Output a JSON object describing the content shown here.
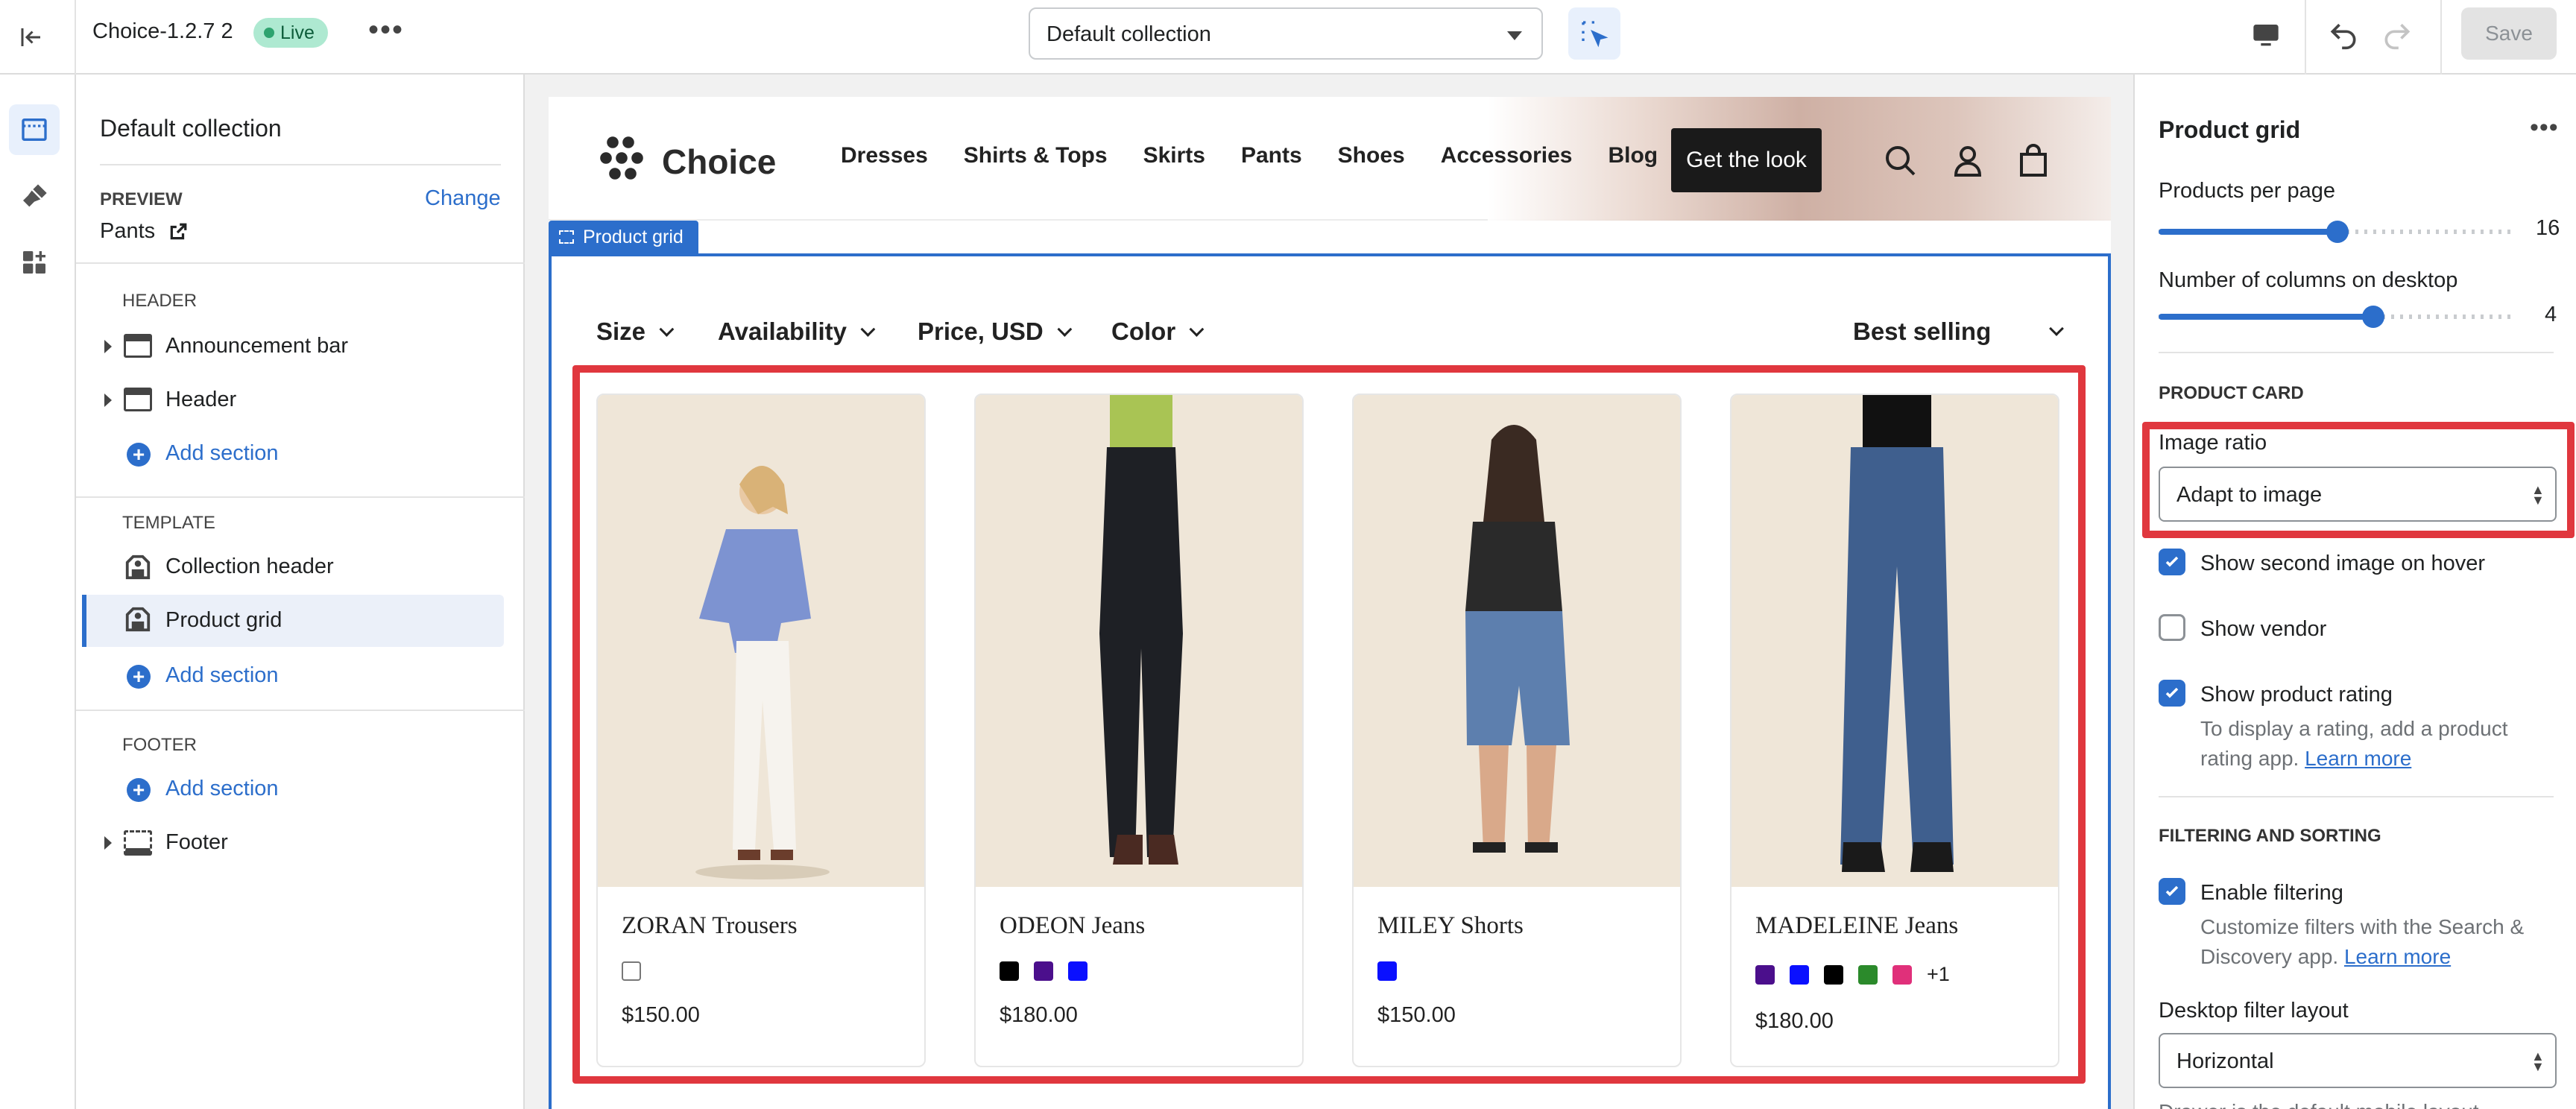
{
  "topbar": {
    "theme_name": "Choice-1.2.7 2",
    "live_badge": "Live",
    "template_select": "Default collection",
    "save_label": "Save"
  },
  "sidebar": {
    "title": "Default collection",
    "preview_label": "PREVIEW",
    "change_label": "Change",
    "preview_value": "Pants",
    "header_group": "HEADER",
    "announcement_bar": "Announcement bar",
    "header_item": "Header",
    "add_section": "Add section",
    "template_group": "TEMPLATE",
    "collection_header": "Collection header",
    "product_grid": "Product grid",
    "footer_group": "FOOTER",
    "footer_item": "Footer"
  },
  "store": {
    "logo_text": "Choice",
    "nav": [
      "Dresses",
      "Shirts & Tops",
      "Skirts",
      "Pants",
      "Shoes",
      "Accessories",
      "Blog"
    ],
    "cta": "Get the look",
    "section_tag": "Product grid",
    "filters": [
      "Size",
      "Availability",
      "Price, USD",
      "Color"
    ],
    "sort": "Best selling",
    "products": [
      {
        "name": "ZORAN Trousers",
        "price": "$150.00",
        "swatches": [
          "#ffffff"
        ],
        "more": ""
      },
      {
        "name": "ODEON Jeans",
        "price": "$180.00",
        "swatches": [
          "#000000",
          "#4b0f8c",
          "#0a10ff"
        ],
        "more": ""
      },
      {
        "name": "MILEY Shorts",
        "price": "$150.00",
        "swatches": [
          "#0a10ff"
        ],
        "more": ""
      },
      {
        "name": "MADELEINE Jeans",
        "price": "$180.00",
        "swatches": [
          "#4b0f8c",
          "#0a10ff",
          "#000000",
          "#2b8a2b",
          "#e0307a"
        ],
        "more": "+1"
      }
    ]
  },
  "settings": {
    "title": "Product grid",
    "products_per_page_label": "Products per page",
    "products_per_page_value": "16",
    "products_per_page_fraction": 0.5,
    "columns_label": "Number of columns on desktop",
    "columns_value": "4",
    "columns_fraction": 0.6,
    "product_card_heading": "PRODUCT CARD",
    "image_ratio_label": "Image ratio",
    "image_ratio_value": "Adapt to image",
    "show_second_image": "Show second image on hover",
    "show_vendor": "Show vendor",
    "show_rating": "Show product rating",
    "rating_help_1": "To display a rating, add a product",
    "rating_help_2": "rating app.",
    "learn_more": "Learn more",
    "filtering_heading": "FILTERING AND SORTING",
    "enable_filtering": "Enable filtering",
    "filtering_help_1": "Customize filters with the Search &",
    "filtering_help_2": "Discovery app.",
    "desktop_filter_label": "Desktop filter layout",
    "desktop_filter_value": "Horizontal",
    "drawer_note": "Drawer is the default mobile layout."
  },
  "colors": {
    "accent": "#2c6ecb",
    "highlight": "#e0373e",
    "live_bg": "#aee9d1",
    "product_bg": "#efe6d8"
  }
}
